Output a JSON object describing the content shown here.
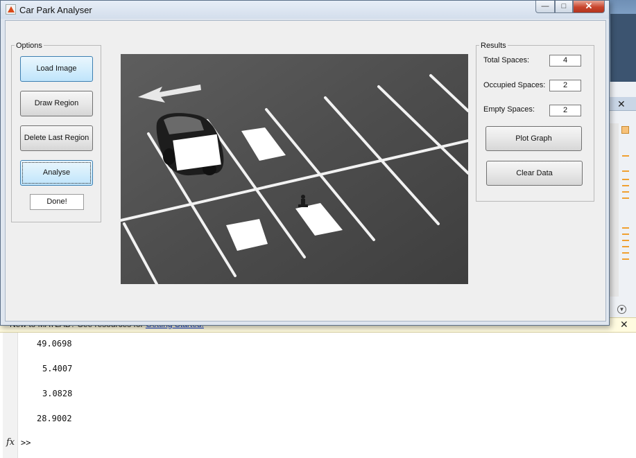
{
  "window": {
    "title": "Car Park Analyser",
    "min_glyph": "—",
    "max_glyph": "□",
    "close_glyph": "✕"
  },
  "options": {
    "group_title": "Options",
    "load_image": "Load Image",
    "draw_region": "Draw Region",
    "delete_last_region": "Delete Last Region",
    "analyse": "Analyse",
    "done": "Done!"
  },
  "results": {
    "group_title": "Results",
    "total_label": "Total Spaces:",
    "total_value": "4",
    "occupied_label": "Occupied Spaces:",
    "occupied_value": "2",
    "empty_label": "Empty Spaces:",
    "empty_value": "2",
    "plot_graph": "Plot Graph",
    "clear_data": "Clear Data"
  },
  "matlab": {
    "info_prefix": "New to MATLAB? See resources for ",
    "info_link": "Getting Started.",
    "info_close": "✕",
    "panel_close": "✕",
    "output": [
      "49.0698",
      "5.4007",
      "3.0828",
      "28.9002"
    ],
    "fx": "fx",
    "prompt": ">>"
  }
}
